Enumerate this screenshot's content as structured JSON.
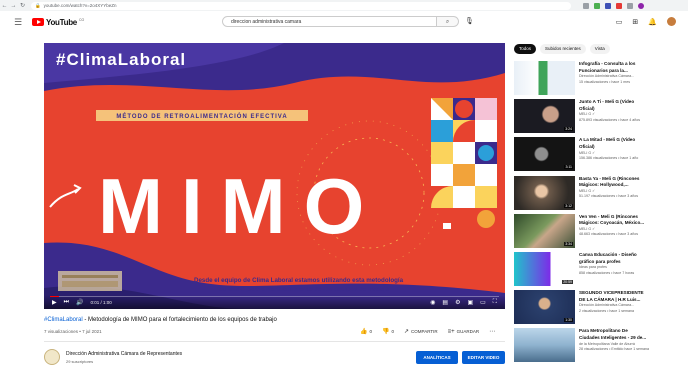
{
  "browser": {
    "url": "youtube.com/watch?v=2o4XYYbeZn"
  },
  "header": {
    "logo_text": "YouTube",
    "logo_sup": "CO",
    "search_value": "direccion administrativa camara"
  },
  "player": {
    "hashtag_overlay": "#ClimaLaboral",
    "method_label": "MÉTODO DE RETROALIMENTACIÓN EFECTIVA",
    "big_word": "MIMO",
    "caption_line1": "Desde el equipo de Clima Laboral estamos utilizando esta metodología",
    "caption_line2": "de MIMO para el fortalecimiento de los equipos de trabajo",
    "time": "0:01 / 1:00",
    "progress": 0.02
  },
  "video": {
    "hashtag": "#ClimaLaboral",
    "title": " - Metodología de MIMO para el fortalecimiento de los equipos de trabajo",
    "views": "7 visualizaciones • 7 jul 2021",
    "likes": "0",
    "dislikes": "0",
    "share_label": "COMPARTIR",
    "save_label": "GUARDAR"
  },
  "channel": {
    "name": "Dirección Administrativa Cámara de Representantes",
    "subs": "29 suscriptores",
    "analytics_label": "ANALÍTICAS",
    "edit_label": "EDITAR VIDEO"
  },
  "sidebar": {
    "chips": [
      "Todos",
      "Subidos recientes",
      "Vista"
    ],
    "related": [
      {
        "title1": "Infografía - Consulta a los",
        "title2": "Funcionarios para la...",
        "meta1": "Dirección Administrativa Cámara...",
        "meta2": "15 visualizaciones • hace 1 mes",
        "duration": "",
        "thumb": "info"
      },
      {
        "title1": "Junto A Ti - Meli G (Video",
        "title2": "Oficial)",
        "meta1": "MELI G ✓",
        "meta2": "875.893 visualizaciones • hace 4 años",
        "duration": "3:24",
        "thumb": "dark"
      },
      {
        "title1": "A La Mitad - Meli G (Video",
        "title2": "Oficial)",
        "meta1": "MELI G ✓",
        "meta2": "156.386 visualizaciones • hace 1 año",
        "duration": "3:11",
        "thumb": "dark2"
      },
      {
        "title1": "Basta Ya - Meli G (Rincones",
        "title2": "Mágicos: Hollywood,...",
        "meta1": "MELI G ✓",
        "meta2": "51.197 visualizaciones • hace 3 años",
        "duration": "3:12",
        "thumb": "warm"
      },
      {
        "title1": "Ven Ven - Meli G (Rincones",
        "title2": "Mágicos: Coyoacán, México...",
        "meta1": "MELI G ✓",
        "meta2": "48.663 visualizaciones • hace 3 años",
        "duration": "3:34",
        "thumb": "green"
      },
      {
        "title1": "Canva Educación - Diseño",
        "title2": "gráfico para profes",
        "meta1": "Ideas para profes",
        "meta2": "858 visualizaciones • hace 7 horas",
        "duration": "20:59",
        "thumb": "canva"
      },
      {
        "title1": "SEGUNDO VICEPRESIDENTE",
        "title2": "DE LA CÁMARA | H.R Luis...",
        "meta1": "Dirección Administrativa Cámara...",
        "meta2": "2 visualizaciones • hace 1 semana",
        "duration": "1:30",
        "thumb": "person"
      },
      {
        "title1": "Para Metropolitano De",
        "title2": "Ciudades Inteligentes - 29 de...",
        "meta1": "de la Metropolitana Valle de Aburrá",
        "meta2": "28 visualizaciones • Emitido hace 1 semana",
        "duration": "",
        "thumb": "city"
      }
    ]
  }
}
